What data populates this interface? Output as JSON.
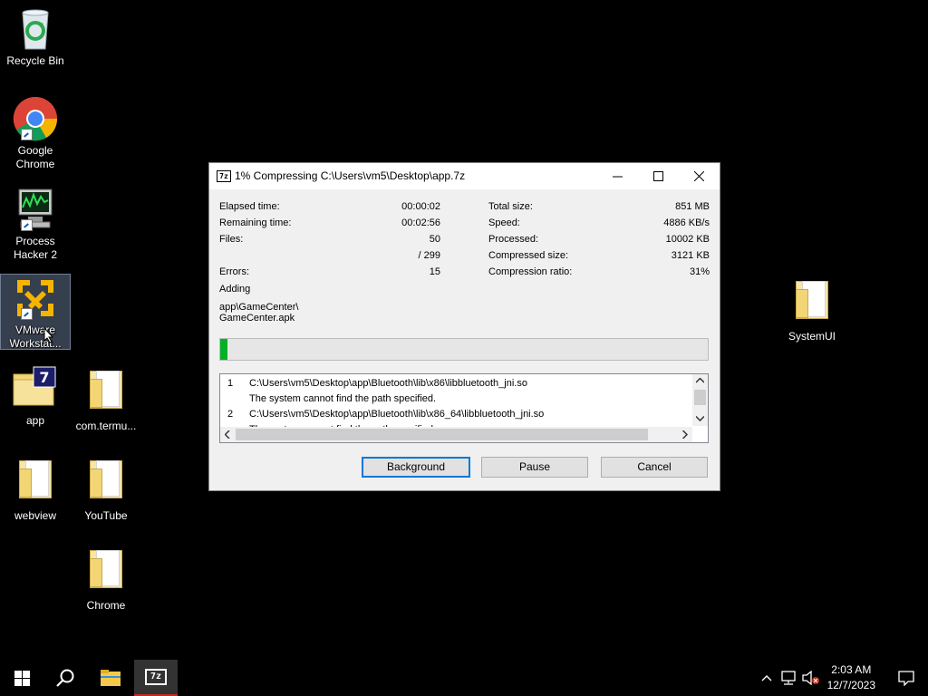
{
  "desktop": {
    "icons": [
      {
        "label": "Recycle Bin",
        "icon": "recycle-bin-icon"
      },
      {
        "label": "Google Chrome",
        "icon": "chrome-icon"
      },
      {
        "label": "Process Hacker 2",
        "icon": "process-hacker-icon"
      },
      {
        "label": "VMware Workstat...",
        "icon": "vmware-icon"
      },
      {
        "label": "app",
        "icon": "7zip-archive-icon"
      },
      {
        "label": "com.termu...",
        "icon": "folder-icon"
      },
      {
        "label": "webview",
        "icon": "folder-icon"
      },
      {
        "label": "YouTube",
        "icon": "folder-icon"
      },
      {
        "label": "Chrome",
        "icon": "folder-icon"
      },
      {
        "label": "SystemUI",
        "icon": "folder-icon"
      }
    ]
  },
  "dialog": {
    "title": "1% Compressing C:\\Users\\vm5\\Desktop\\app.7z",
    "title_icon": "7z",
    "left_stats": {
      "elapsed_label": "Elapsed time:",
      "elapsed_value": "00:00:02",
      "remaining_label": "Remaining time:",
      "remaining_value": "00:02:56",
      "files_label": "Files:",
      "files_value": "50",
      "files_total": "/ 299",
      "errors_label": "Errors:",
      "errors_value": "15"
    },
    "right_stats": {
      "total_label": "Total size:",
      "total_value": "851 MB",
      "speed_label": "Speed:",
      "speed_value": "4886 KB/s",
      "processed_label": "Processed:",
      "processed_value": "10002 KB",
      "compressed_label": "Compressed size:",
      "compressed_value": "3121 KB",
      "ratio_label": "Compression ratio:",
      "ratio_value": "31%"
    },
    "adding_label": "Adding",
    "current_path_line1": "app\\GameCenter\\",
    "current_path_line2": "GameCenter.apk",
    "progress_fraction": 0.01,
    "progress_color": "#06b025",
    "log": [
      {
        "num": "1",
        "text": "C:\\Users\\vm5\\Desktop\\app\\Bluetooth\\lib\\x86\\libbluetooth_jni.so"
      },
      {
        "num": "",
        "text": "The system cannot find the path specified."
      },
      {
        "num": "2",
        "text": "C:\\Users\\vm5\\Desktop\\app\\Bluetooth\\lib\\x86_64\\libbluetooth_jni.so"
      },
      {
        "num": "",
        "text": "The system cannot find the path specified."
      }
    ],
    "buttons": {
      "background": "Background",
      "pause": "Pause",
      "cancel": "Cancel"
    }
  },
  "taskbar": {
    "time": "2:03 AM",
    "date": "12/7/2023",
    "active_app": "7z"
  }
}
